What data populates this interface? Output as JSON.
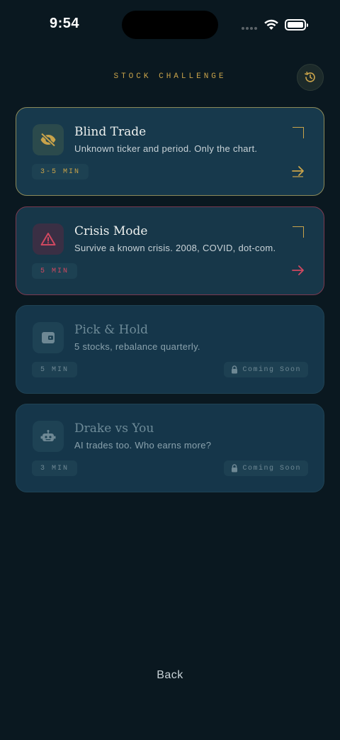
{
  "status_bar": {
    "time": "9:54"
  },
  "header": {
    "title": "STOCK CHALLENGE",
    "history_icon": "history-icon"
  },
  "colors": {
    "background": "#0a1820",
    "accent_gold": "#c9a34a",
    "accent_red": "#d04860",
    "card": "#17374a"
  },
  "cards": [
    {
      "title": "Blind Trade",
      "description": "Unknown ticker and period. Only the chart.",
      "time": "3-5 MIN",
      "icon": "eye-slash-icon",
      "status": "available"
    },
    {
      "title": "Crisis Mode",
      "description": "Survive a known crisis. 2008, COVID, dot-com.",
      "time": "5 MIN",
      "icon": "warning-icon",
      "status": "available"
    },
    {
      "title": "Pick & Hold",
      "description": "5 stocks, rebalance quarterly.",
      "time": "5 MIN",
      "icon": "wallet-icon",
      "status": "Coming Soon"
    },
    {
      "title": "Drake vs You",
      "description": "AI trades too. Who earns more?",
      "time": "3 MIN",
      "icon": "robot-icon",
      "status": "Coming Soon"
    }
  ],
  "footer": {
    "back_label": "Back"
  }
}
